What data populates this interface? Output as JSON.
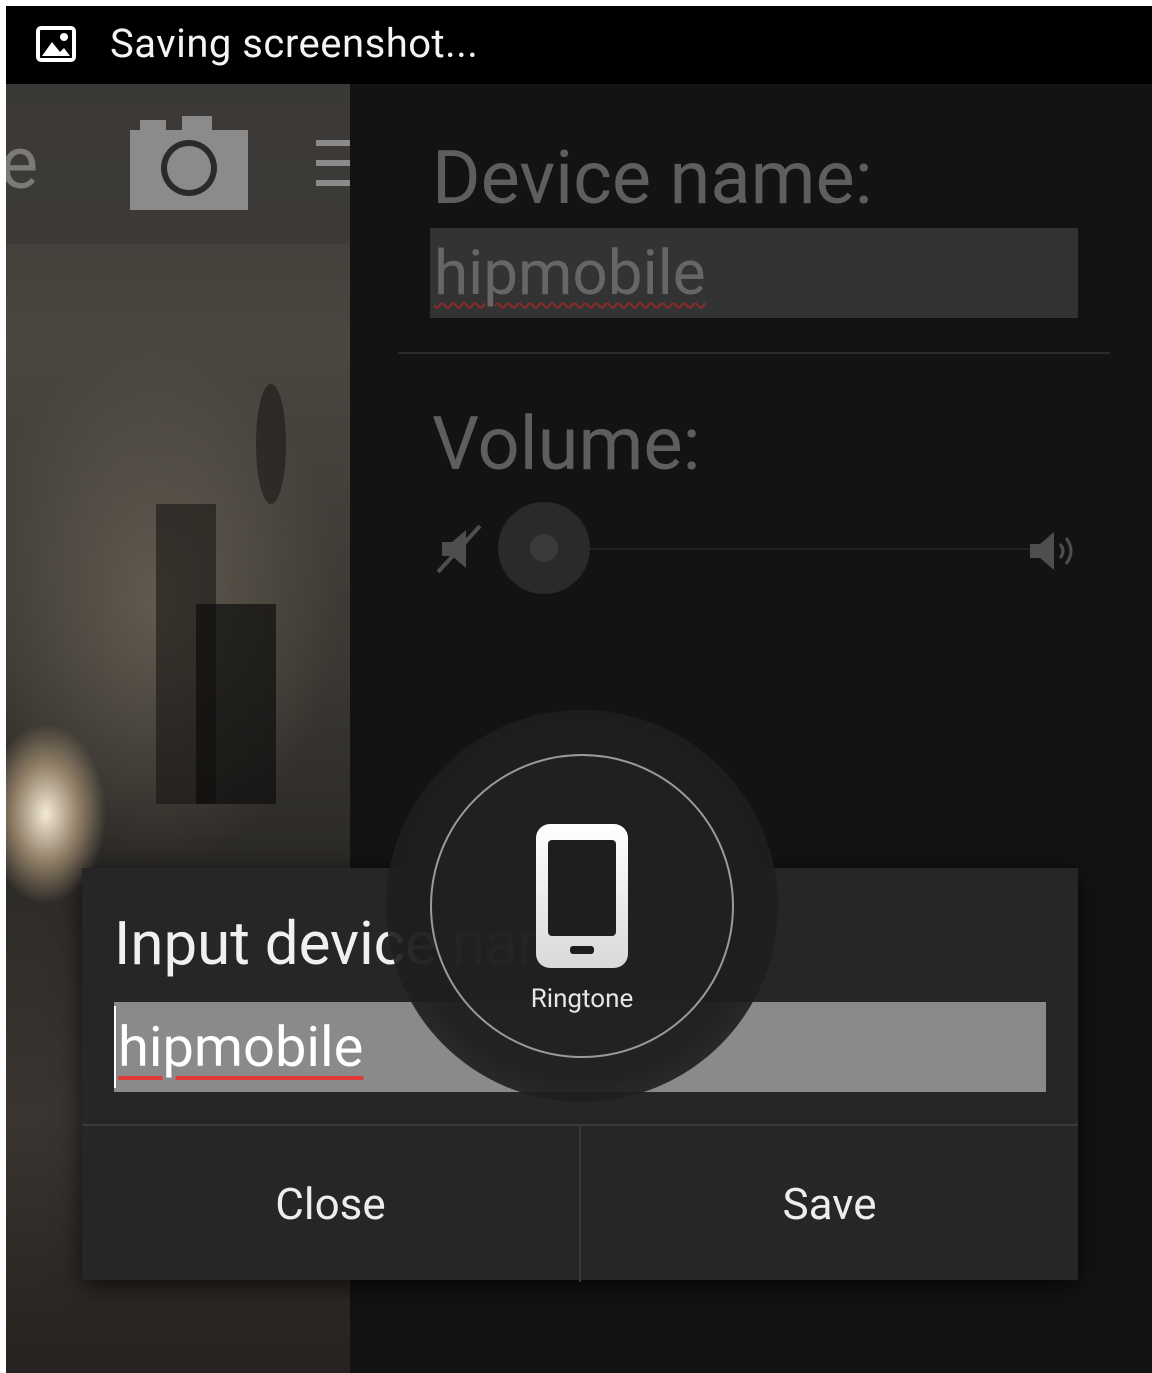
{
  "status_bar": {
    "icon": "image-icon",
    "text": "Saving screenshot..."
  },
  "camera_app": {
    "partial_letter": "e",
    "camera_icon": "camera-icon",
    "menu_icon": "menu-icon"
  },
  "settings": {
    "device_name_label": "Device name:",
    "device_name_value": "hipmobile",
    "volume_label": "Volume:",
    "volume_level": 0,
    "mute_icon": "mute-icon",
    "speaker_icon": "speaker-icon"
  },
  "dialog": {
    "title": "Input device name",
    "input_value": "hipmobile",
    "close_label": "Close",
    "save_label": "Save"
  },
  "ringer_overlay": {
    "icon": "phone-icon",
    "label": "Ringtone"
  }
}
